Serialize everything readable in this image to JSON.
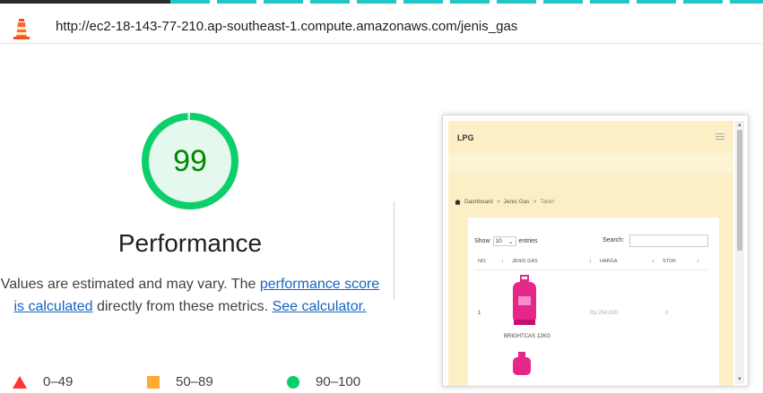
{
  "browser": {
    "url": "http://ec2-18-143-77-210.ap-southeast-1.compute.amazonaws.com/jenis_gas"
  },
  "report": {
    "score": "99",
    "category_title": "Performance",
    "description_start": "Values are estimated and may vary. The ",
    "score_link": "performance score is calculated",
    "description_mid": " directly from these metrics. ",
    "calculator_link": "See calculator.",
    "score_color": "#0cce6b"
  },
  "legend": [
    {
      "range": "0–49",
      "shape": "triangle",
      "color": "#ff3333"
    },
    {
      "range": "50–89",
      "shape": "square",
      "color": "#ffaa33"
    },
    {
      "range": "90–100",
      "shape": "circle",
      "color": "#0cce6b"
    }
  ],
  "screenshot": {
    "app_title": "LPG",
    "breadcrumb": [
      "Dashboard",
      "Jenis Gas",
      "Tabel"
    ],
    "show_label": "Show",
    "show_value": "10",
    "entries_label": "entries",
    "search_label": "Search:",
    "columns": [
      "NO.",
      "JENIS GAS",
      "HARGA",
      "STOK"
    ],
    "rows": [
      {
        "no": "1",
        "name": "BRIGHTCAS 12KG",
        "price": "Rp 204,000",
        "stok": "0"
      }
    ]
  }
}
